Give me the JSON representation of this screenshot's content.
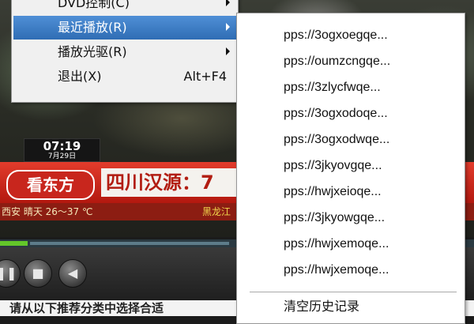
{
  "player": {
    "clock_time": "07:19",
    "clock_date": "7月29日",
    "ticker_logo": "看东方",
    "ticker_title": "四川汉源：7",
    "weather_left": "西安 晴天 26～37 ℃",
    "weather_right": "黑龙江"
  },
  "controls": {
    "pause_icon": "pause-icon",
    "stop_icon": "stop-icon",
    "volume_icon": "speaker-icon"
  },
  "bottom_text": "请从以下推荐分类中选择合适",
  "menu": {
    "items": [
      {
        "label": "DVD控制(C)",
        "has_submenu": true
      },
      {
        "label": "最近播放(R)",
        "has_submenu": true,
        "highlighted": true
      },
      {
        "label": "播放光驱(R)",
        "has_submenu": true
      },
      {
        "label": "退出(X)",
        "accelerator": "Alt+F4"
      }
    ]
  },
  "submenu": {
    "items": [
      "pps://3ogxoegqe...",
      "pps://oumzcngqe...",
      "pps://3zlycfwqe...",
      "pps://3ogxodoqe...",
      "pps://3ogxodwqe...",
      "pps://3jkyovgqe...",
      "pps://hwjxeioqe...",
      "pps://3jkyowgqe...",
      "pps://hwjxemoqe...",
      "pps://hwjxemoqe..."
    ],
    "clear_history": "清空历史记录"
  },
  "colors": {
    "menu_highlight": "#3877c4",
    "ticker_red": "#c8261d",
    "seek_green": "#63c72a"
  }
}
